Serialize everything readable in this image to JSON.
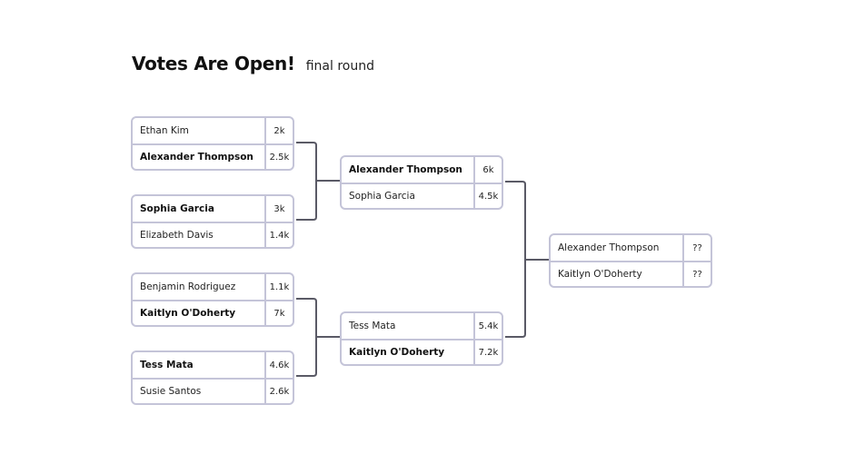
{
  "header": {
    "title": "Votes Are Open!",
    "subtitle": "final round"
  },
  "colors": {
    "border": "#c4c4d8",
    "connector": "#5a5a66",
    "text": "#111111"
  },
  "rounds": [
    {
      "name": "round-1",
      "matches": [
        {
          "players": [
            {
              "name": "Ethan Kim",
              "score": "2k",
              "winner": false
            },
            {
              "name": "Alexander Thompson",
              "score": "2.5k",
              "winner": true
            }
          ]
        },
        {
          "players": [
            {
              "name": "Sophia Garcia",
              "score": "3k",
              "winner": true
            },
            {
              "name": "Elizabeth Davis",
              "score": "1.4k",
              "winner": false
            }
          ]
        },
        {
          "players": [
            {
              "name": "Benjamin Rodriguez",
              "score": "1.1k",
              "winner": false
            },
            {
              "name": "Kaitlyn O'Doherty",
              "score": "7k",
              "winner": true
            }
          ]
        },
        {
          "players": [
            {
              "name": "Tess Mata",
              "score": "4.6k",
              "winner": true
            },
            {
              "name": "Susie Santos",
              "score": "2.6k",
              "winner": false
            }
          ]
        }
      ]
    },
    {
      "name": "round-2",
      "matches": [
        {
          "players": [
            {
              "name": "Alexander Thompson",
              "score": "6k",
              "winner": true
            },
            {
              "name": "Sophia Garcia",
              "score": "4.5k",
              "winner": false
            }
          ]
        },
        {
          "players": [
            {
              "name": "Tess Mata",
              "score": "5.4k",
              "winner": false
            },
            {
              "name": "Kaitlyn O'Doherty",
              "score": "7.2k",
              "winner": true
            }
          ]
        }
      ]
    },
    {
      "name": "final",
      "matches": [
        {
          "players": [
            {
              "name": "Alexander Thompson",
              "score": "??",
              "winner": false
            },
            {
              "name": "Kaitlyn O'Doherty",
              "score": "??",
              "winner": false
            }
          ]
        }
      ]
    }
  ]
}
